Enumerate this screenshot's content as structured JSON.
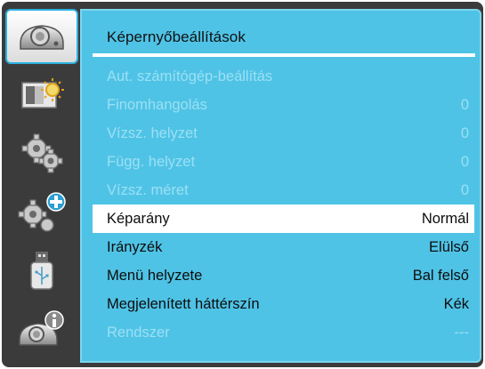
{
  "menu": {
    "title": "Képernyőbeállítások",
    "rows": [
      {
        "label": "Aut. számítógép-beállítás",
        "value": ""
      },
      {
        "label": "Finomhangolás",
        "value": "0"
      },
      {
        "label": "Vízsz. helyzet",
        "value": "0"
      },
      {
        "label": "Függ. helyzet",
        "value": "0"
      },
      {
        "label": "Vízsz. méret",
        "value": "0"
      },
      {
        "label": "Képarány",
        "value": "Normál"
      },
      {
        "label": "Irányzék",
        "value": "Elülső"
      },
      {
        "label": "Menü helyzete",
        "value": "Bal felső"
      },
      {
        "label": "Megjelenített háttérszín",
        "value": "Kék"
      },
      {
        "label": "Rendszer",
        "value": "---"
      }
    ]
  },
  "sidebar": {
    "items": [
      {
        "icon": "projector-display-icon",
        "active": true
      },
      {
        "icon": "picture-adjust-icon",
        "active": false
      },
      {
        "icon": "gears-setting-icon",
        "active": false
      },
      {
        "icon": "gears-plus-icon",
        "active": false
      },
      {
        "icon": "usb-icon",
        "active": false
      },
      {
        "icon": "projector-info-icon",
        "active": false
      }
    ]
  },
  "colors": {
    "frame": "#3b3b3b",
    "panel": "#4fc3e6",
    "disabled_text": "#9be0f4",
    "selected_row": "#ffffff",
    "active_border": "#2bb0de"
  }
}
